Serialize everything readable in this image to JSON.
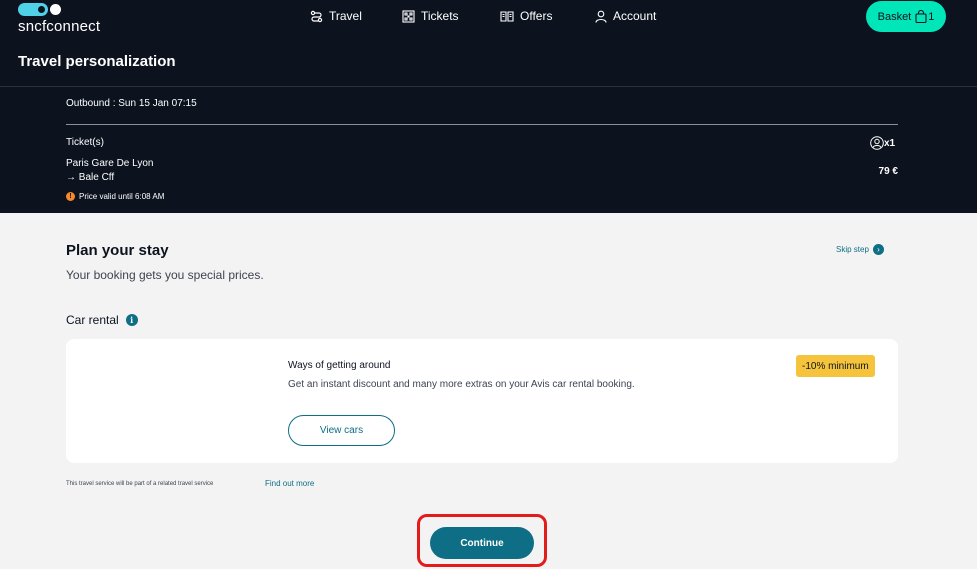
{
  "header": {
    "logo_text": "sncfconnect",
    "nav": {
      "travel": "Travel",
      "tickets": "Tickets",
      "offers": "Offers",
      "account": "Account"
    },
    "basket": {
      "label": "Basket",
      "count": "1"
    },
    "page_title": "Travel personalization"
  },
  "journey": {
    "outbound": "Outbound : Sun 15 Jan 07:15",
    "tickets_label": "Ticket(s)",
    "passengers": "x1",
    "origin": "Paris Gare De Lyon",
    "destination": "Bale Cff",
    "destination_arrow": "→",
    "price": "79 €",
    "validity": "Price valid until 6:08 AM",
    "warning_glyph": "!"
  },
  "plan": {
    "title": "Plan your stay",
    "subtitle": "Your booking gets you special prices.",
    "skip_label": "Skip step"
  },
  "car_rental": {
    "section_title": "Car rental",
    "info_glyph": "i",
    "offer_title": "Ways of getting around",
    "offer_description": "Get an instant discount and many more extras on your Avis car rental booking.",
    "badge": "-10% minimum",
    "cta": "View cars"
  },
  "footer": {
    "disclaimer": "This travel service will be part of a related travel service",
    "find_out_more": "Find out more",
    "continue_label": "Continue"
  },
  "colors": {
    "header_bg": "#0c131f",
    "accent_mint": "#00e6b8",
    "primary_teal": "#0e6e85",
    "badge_yellow": "#f6c33d",
    "warning_orange": "#f38b2a",
    "highlight_red": "#e21b1b"
  }
}
